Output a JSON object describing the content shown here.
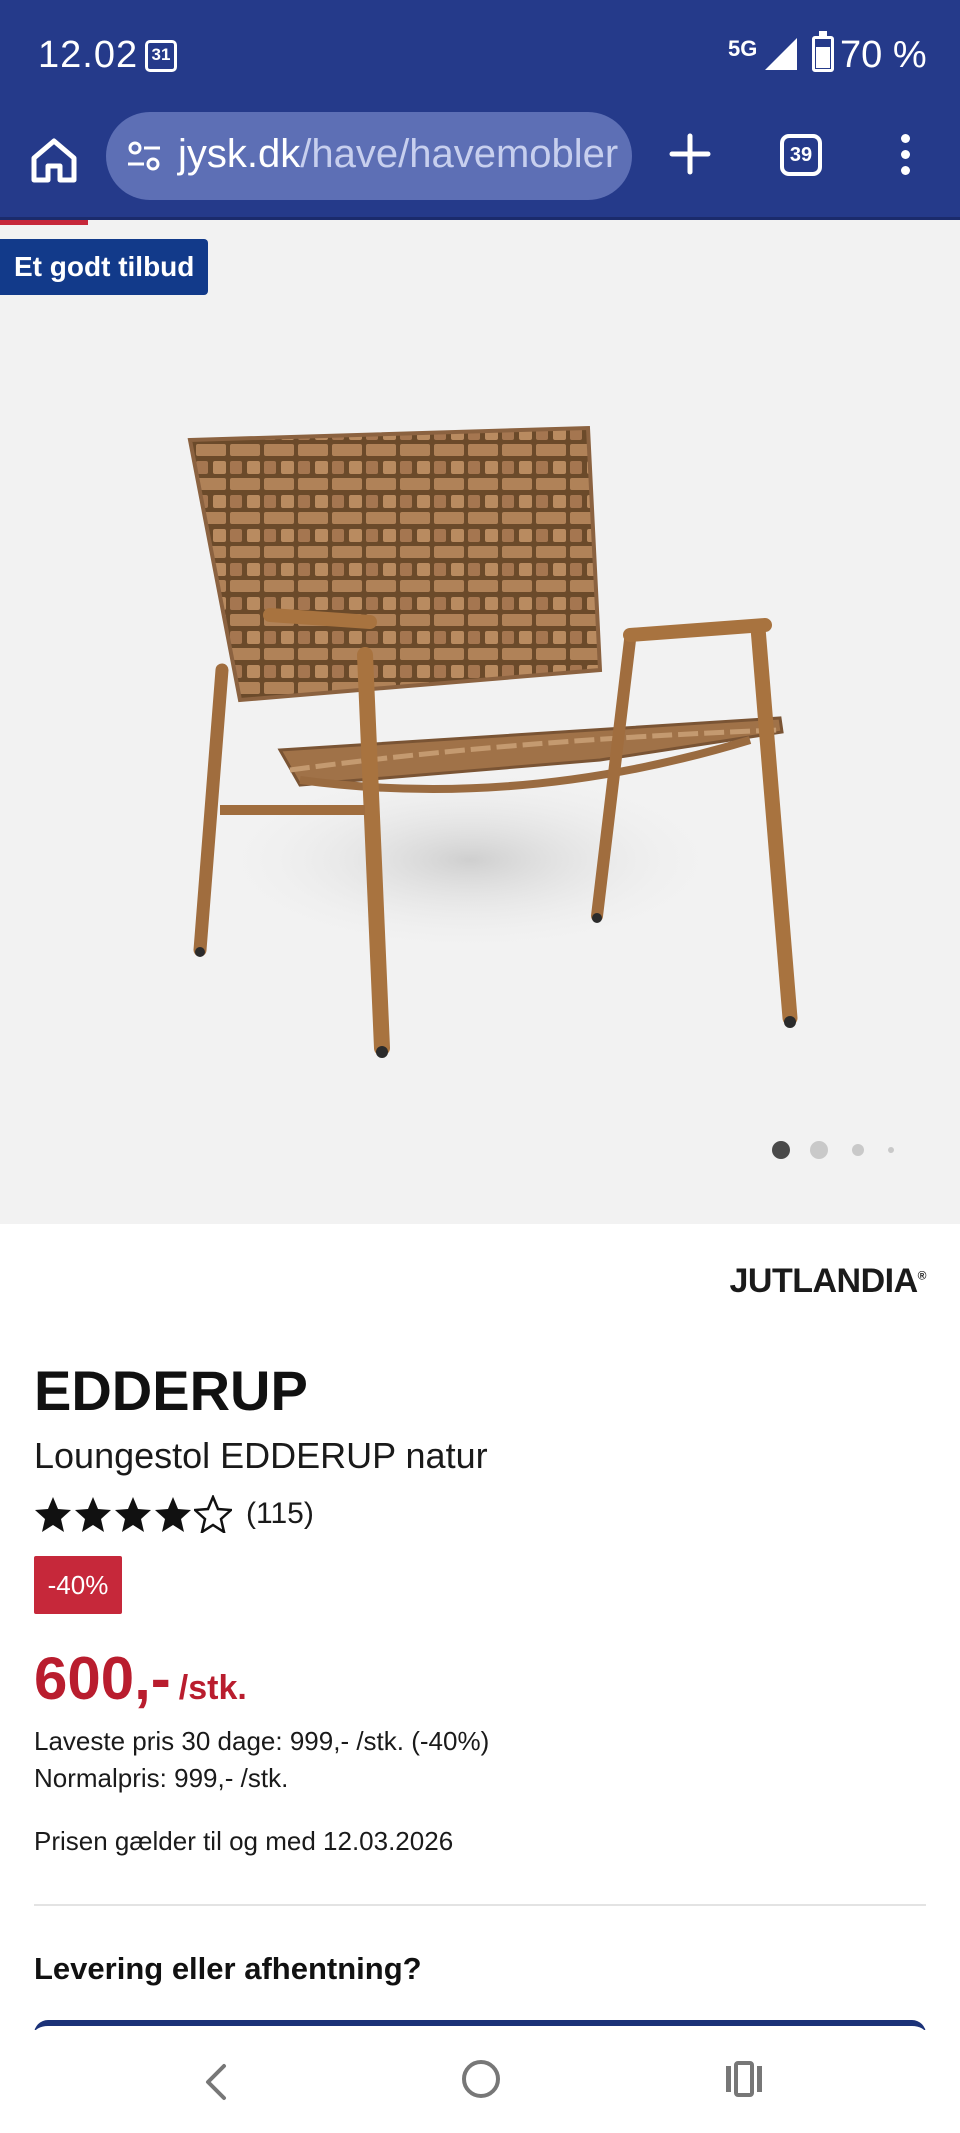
{
  "status_bar": {
    "time": "12.02",
    "calendar_day": "31",
    "network": "5G",
    "battery": "70 %"
  },
  "browser": {
    "url_domain": "jysk.dk",
    "url_path": "/have/havemobler",
    "tab_count": "39"
  },
  "gallery": {
    "offer_badge": "Et godt tilbud",
    "active_slide": 1,
    "slide_count": 4
  },
  "product": {
    "brand": "JUTLANDIA",
    "name": "EDDERUP",
    "description": "Loungestol EDDERUP natur",
    "rating_stars": 4,
    "rating_max": 5,
    "rating_count": "(115)",
    "discount": "-40%",
    "price": "600,-",
    "price_unit": "/stk.",
    "lowest_price": "Laveste pris 30 dage: 999,- /stk. (-40%)",
    "normal_price": "Normalpris: 999,- /stk.",
    "valid_until": "Prisen gælder til og med 12.03.2026"
  },
  "delivery": {
    "heading": "Levering eller afhentning?"
  },
  "colors": {
    "brand_blue": "#253a8a",
    "sale_red": "#c6283a"
  },
  "icons": {
    "home": "home-icon",
    "site_info": "tune-icon",
    "new_tab": "plus-icon",
    "tabs": "tabs-icon",
    "menu": "more-vert-icon",
    "back": "back-icon",
    "nav_home": "nav-home-icon",
    "recents": "recents-icon"
  }
}
